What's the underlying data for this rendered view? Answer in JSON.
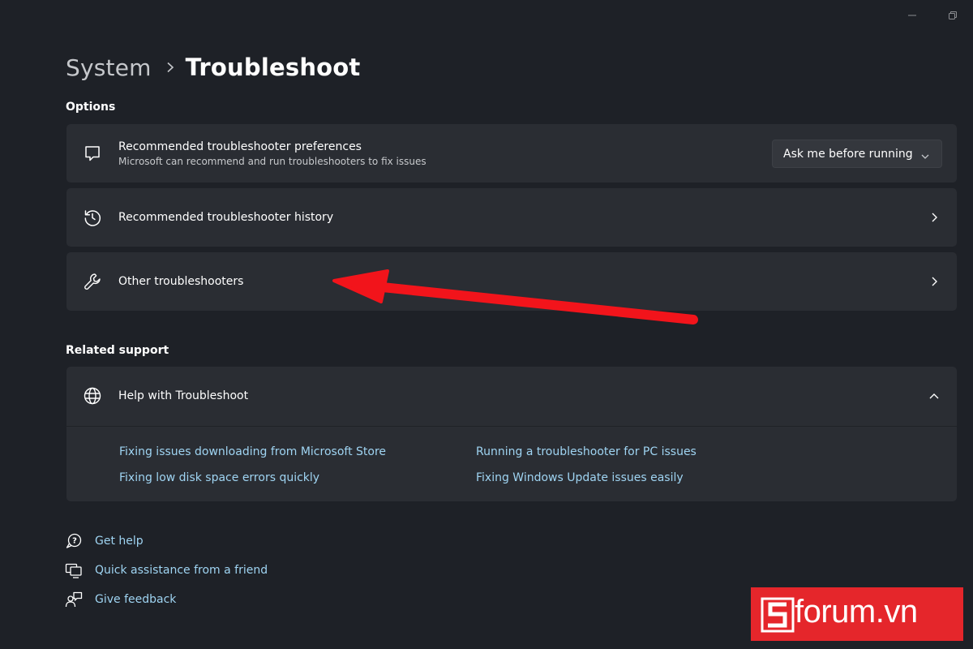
{
  "header": {
    "breadcrumb_parent": "System",
    "breadcrumb_current": "Troubleshoot"
  },
  "options": {
    "section_title": "Options",
    "recommended_prefs": {
      "title": "Recommended troubleshooter preferences",
      "subtitle": "Microsoft can recommend and run troubleshooters to fix issues",
      "dropdown_value": "Ask me before running",
      "icon": "chat-bubble-icon"
    },
    "history": {
      "title": "Recommended troubleshooter history",
      "icon": "history-icon"
    },
    "other": {
      "title": "Other troubleshooters",
      "icon": "wrench-icon"
    }
  },
  "related": {
    "section_title": "Related support",
    "help": {
      "title": "Help with Troubleshoot",
      "icon": "globe-icon",
      "links": [
        "Fixing issues downloading from Microsoft Store",
        "Running a troubleshooter for PC issues",
        "Fixing low disk space errors quickly",
        "Fixing Windows Update issues easily"
      ]
    }
  },
  "bottom_links": [
    {
      "label": "Get help",
      "icon": "help-chat-icon"
    },
    {
      "label": "Quick assistance from a friend",
      "icon": "remote-assist-icon"
    },
    {
      "label": "Give feedback",
      "icon": "feedback-icon"
    }
  ],
  "watermark": {
    "text": "forum.vn",
    "brand": "sforum"
  },
  "colors": {
    "background": "#1e2127",
    "card": "#2a2d33",
    "link": "#9fd4f2",
    "annotation_arrow": "#f2141b",
    "watermark": "#e5262b"
  }
}
